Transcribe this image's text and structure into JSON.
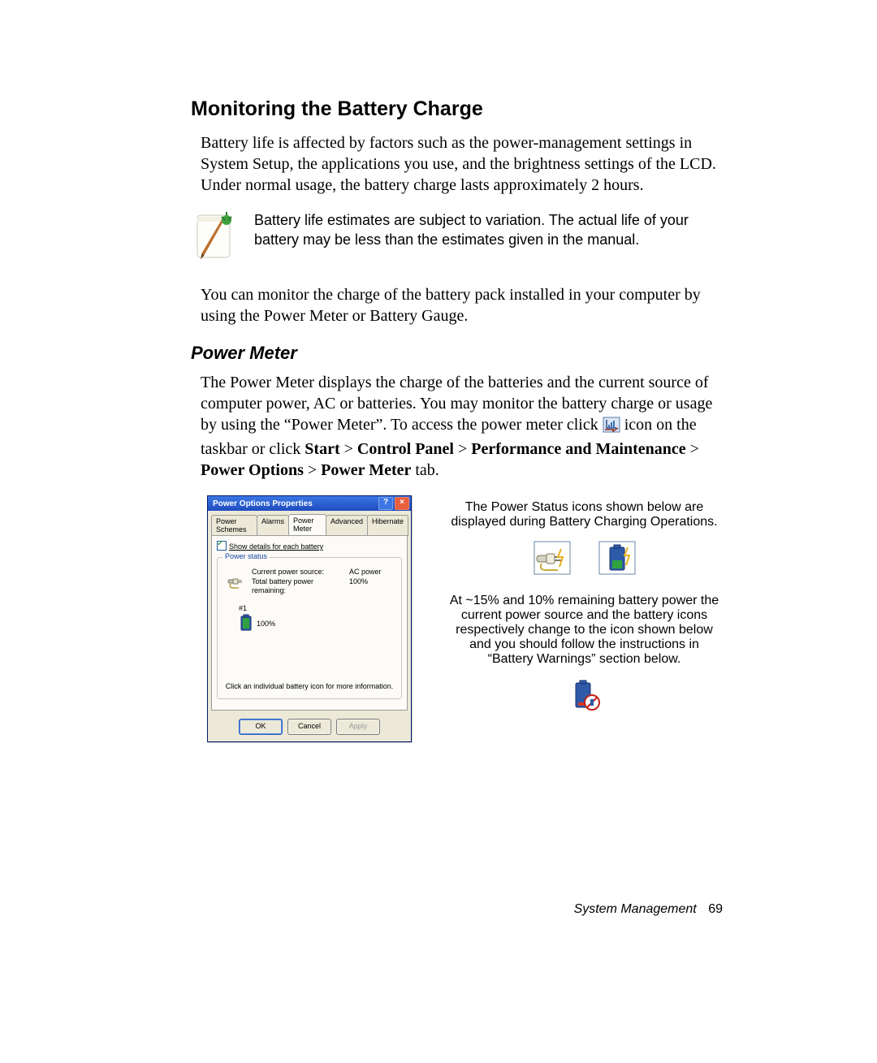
{
  "heading": "Monitoring the Battery Charge",
  "intro": "Battery life is affected by factors such as the power-management settings in System Setup, the applications you use, and the brightness settings of the LCD. Under normal usage, the battery charge lasts approximately 2 hours.",
  "note": "Battery life estimates are subject to variation. The actual life of your battery may be less than the estimates given in the manual.",
  "monitor_para": "You can monitor the charge of the battery pack installed in your computer by using the Power Meter or Battery Gauge.",
  "subheading": "Power Meter",
  "pm_text_pre": "The Power Meter displays the charge of the batteries and the current source of computer power, AC or batteries. You may monitor the battery charge or usage by using the “Power Meter”. To access the power meter click ",
  "pm_text_post_icon": " icon on the taskbar or click ",
  "nav_parts": {
    "start": "Start",
    "sep": " > ",
    "cp": "Control Panel",
    "pm": "Performance and Maintenance",
    "po": "Power Options",
    "pmt": "Power Meter",
    "tab_suffix": " tab."
  },
  "dialog": {
    "title": "Power Options Properties",
    "tabs": [
      "Power Schemes",
      "Alarms",
      "Power Meter",
      "Advanced",
      "Hibernate"
    ],
    "active_tab_index": 2,
    "checkbox_label": "Show details for each battery",
    "group_legend": "Power status",
    "source_label": "Current power source:",
    "source_value": "AC power",
    "remaining_label": "Total battery power remaining:",
    "remaining_value": "100%",
    "batt_id": "#1",
    "batt_pct": "100%",
    "hint": "Click an individual battery icon for more information.",
    "buttons": {
      "ok": "OK",
      "cancel": "Cancel",
      "apply": "Apply"
    }
  },
  "right": {
    "para1": "The Power Status icons shown below are displayed during Battery Charging Operations.",
    "para2": "At ~15% and 10% remaining battery power the current power source  and the battery icons respectively change to the icon shown below and you should follow the instructions in “Battery Warnings” section below."
  },
  "footer": {
    "section": "System Management",
    "page": "69"
  }
}
